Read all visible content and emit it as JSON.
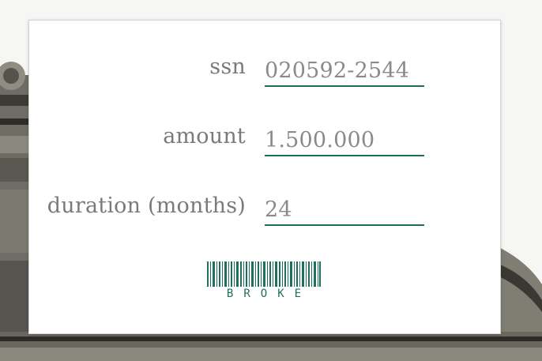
{
  "form": {
    "ssn_label": "ssn",
    "ssn_value": "020592-2544",
    "amount_label": "amount",
    "amount_value": "1.500.000",
    "duration_label": "duration (months)",
    "duration_value": "24"
  },
  "submit": {
    "barcode_text": "BROKE",
    "icon": "barcode-icon"
  },
  "colors": {
    "accent": "#1f6f5e",
    "label": "#7a7a7a",
    "card": "#ffffff"
  }
}
